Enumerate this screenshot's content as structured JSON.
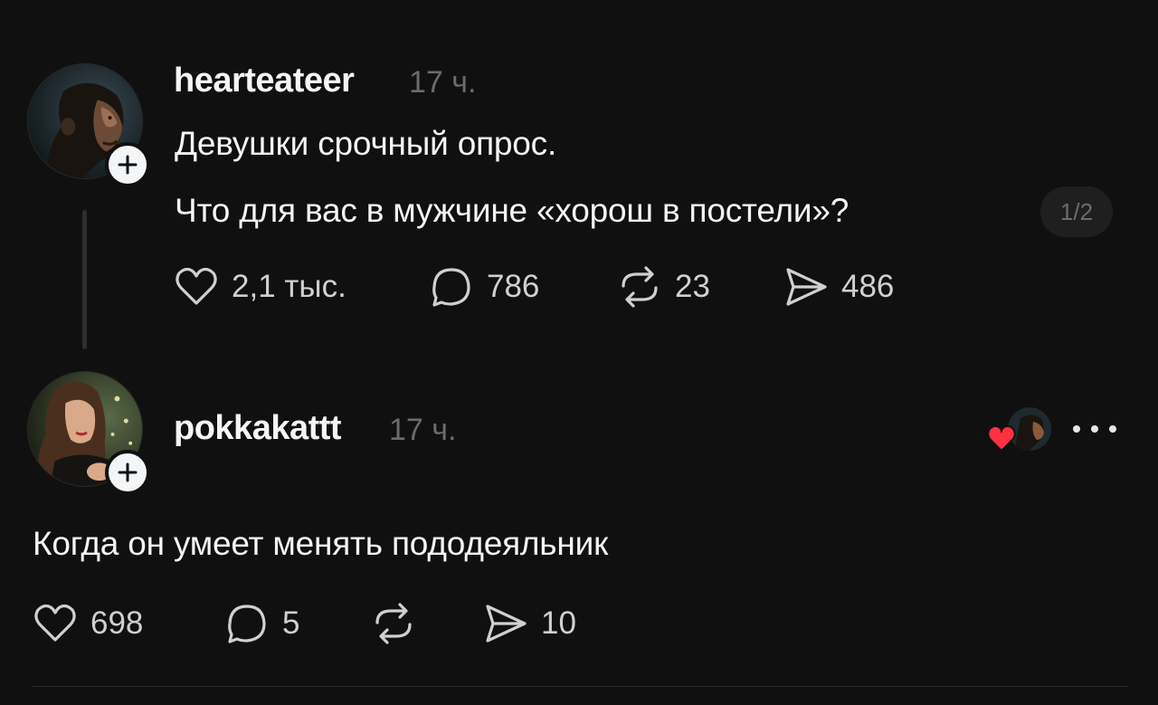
{
  "colors": {
    "background": "#101010",
    "text_primary": "#f3f5f7",
    "text_secondary": "#6b6b6b",
    "heart_red": "#ff3040"
  },
  "post": {
    "username": "hearteateer",
    "time": "17 ч.",
    "avatar_icon": "man-portrait-avatar",
    "follow_icon": "plus-icon",
    "text_line1": "Девушки срочный опрос.",
    "text_line2": "Что для вас в мужчине «хорош в постели»?",
    "page_indicator": "1/2",
    "likes": "2,1 тыс.",
    "comments": "786",
    "reposts": "23",
    "shares": "486"
  },
  "reply": {
    "username": "pokkakattt",
    "time": "17 ч.",
    "avatar_icon": "woman-portrait-avatar",
    "follow_icon": "plus-icon",
    "liked_by_author_icon": "heart-icon",
    "text": "Когда он умеет менять пододеяльник",
    "likes": "698",
    "comments": "5",
    "reposts": "",
    "shares": "10"
  }
}
